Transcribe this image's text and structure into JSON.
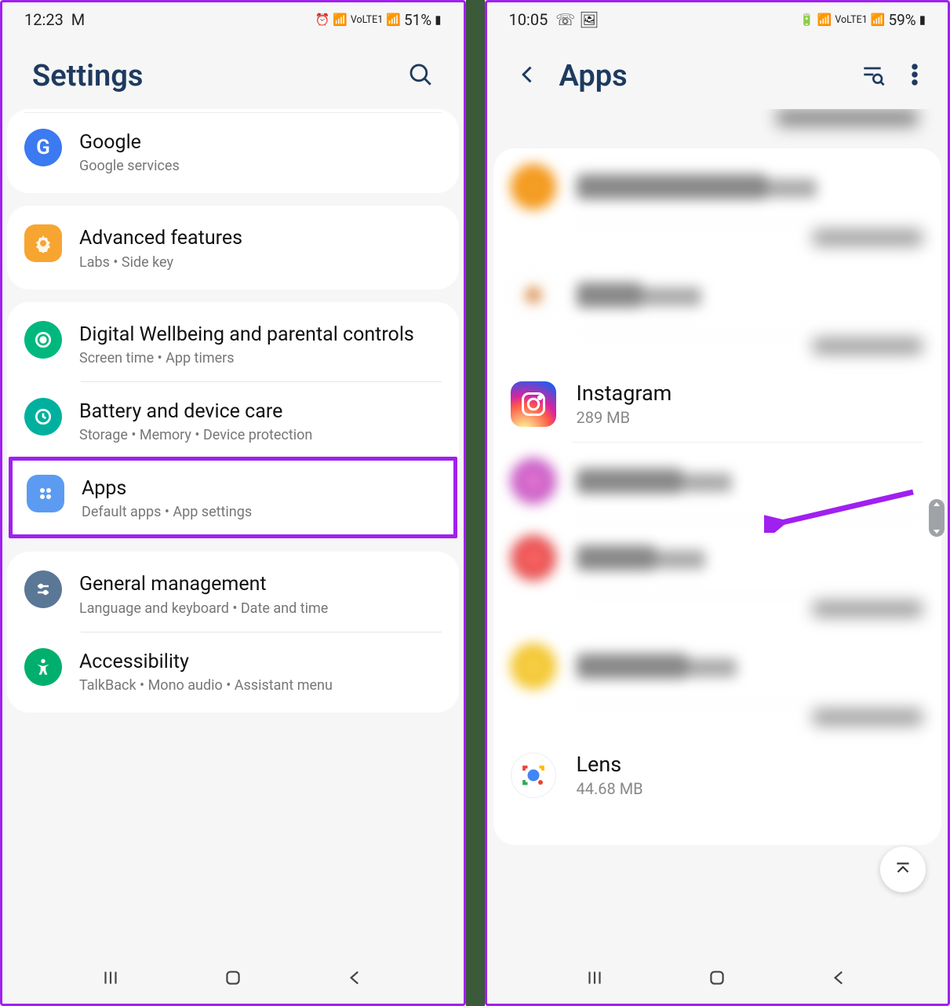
{
  "left": {
    "statusbar": {
      "time": "12:23",
      "battery": "51%"
    },
    "header": {
      "title": "Settings"
    },
    "items": [
      {
        "title": "Google",
        "sub": "Google services",
        "color": "#3b7af0"
      },
      {
        "title": "Advanced features",
        "sub": "Labs  •  Side key",
        "color": "#f7a531"
      },
      {
        "title": "Digital Wellbeing and parental controls",
        "sub": "Screen time  •  App timers",
        "color": "#00b87d"
      },
      {
        "title": "Battery and device care",
        "sub": "Storage  •  Memory  •  Device protection",
        "color": "#00b09e"
      },
      {
        "title": "Apps",
        "sub": "Default apps  •  App settings",
        "color": "#5b9bf2"
      },
      {
        "title": "General management",
        "sub": "Language and keyboard  •  Date and time",
        "color": "#5b7796"
      },
      {
        "title": "Accessibility",
        "sub": "TalkBack  •  Mono audio  •  Assistant menu",
        "color": "#00af6d"
      }
    ]
  },
  "right": {
    "statusbar": {
      "time": "10:05",
      "battery": "59%"
    },
    "header": {
      "title": "Apps"
    },
    "apps": [
      {
        "name": "Instagram",
        "size": "289 MB"
      },
      {
        "name": "Lens",
        "size": "44.68 MB"
      }
    ]
  }
}
